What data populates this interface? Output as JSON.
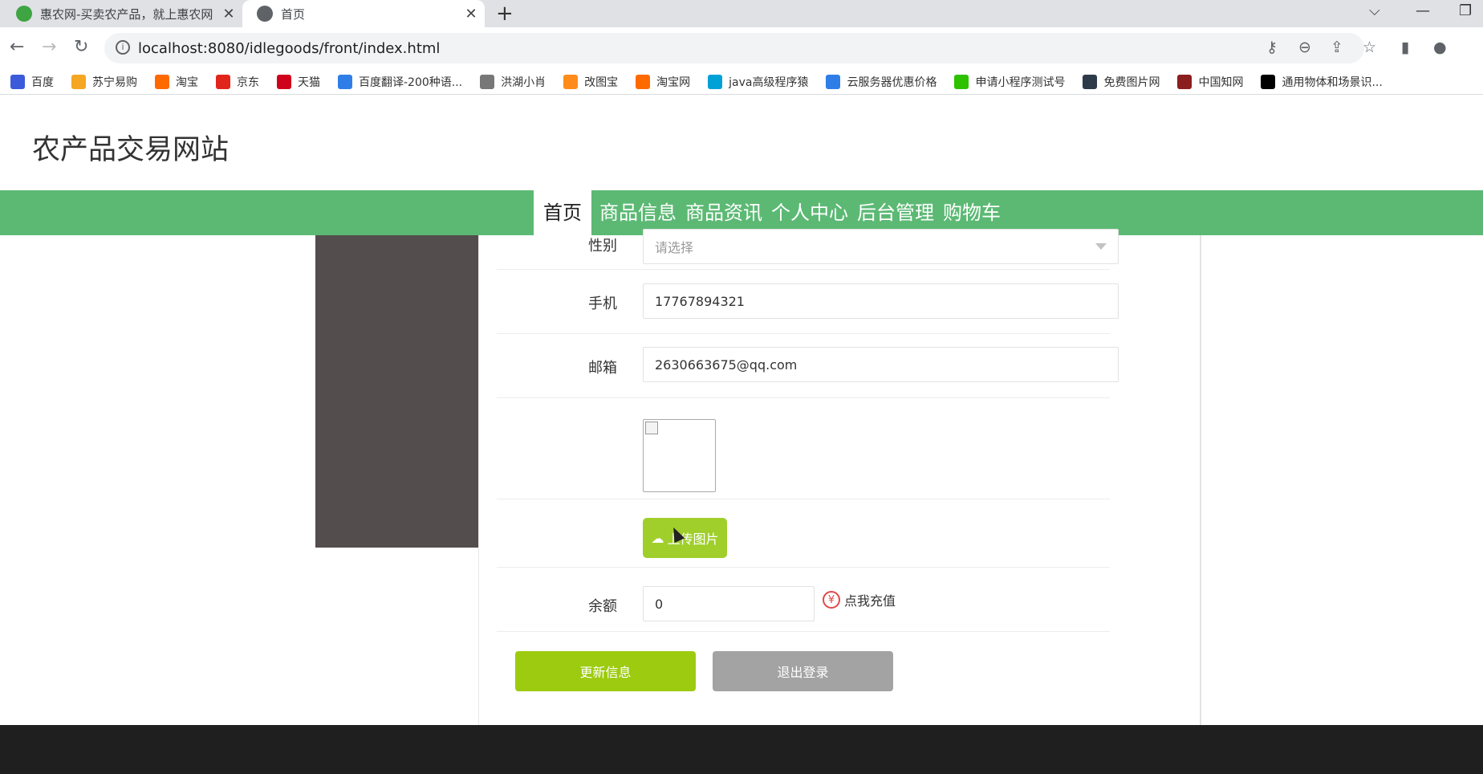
{
  "browser": {
    "tabs": [
      {
        "title": "惠农网-买卖农产品，就上惠农网",
        "active": false,
        "favicon_color": "#3fa543"
      },
      {
        "title": "首页",
        "active": true,
        "favicon_color": "#5f6368"
      }
    ],
    "url": "localhost:8080/idlegoods/front/index.html",
    "bookmarks": [
      {
        "label": "百度",
        "icon": "paw-icon",
        "color": "#3b5bdb"
      },
      {
        "label": "苏宁易购",
        "icon": "lion-icon",
        "color": "#f5a623"
      },
      {
        "label": "淘宝",
        "icon": "taobao-icon",
        "color": "#ff6a00"
      },
      {
        "label": "京东",
        "icon": "jd-icon",
        "color": "#e1251b"
      },
      {
        "label": "天猫",
        "icon": "tmall-icon",
        "color": "#d0021b"
      },
      {
        "label": "百度翻译-200种语...",
        "icon": "translate-icon",
        "color": "#2f7ee8"
      },
      {
        "label": "洪湖小肖",
        "icon": "bird-icon",
        "color": "#777777"
      },
      {
        "label": "改图宝",
        "icon": "image-icon",
        "color": "#ff8c1a"
      },
      {
        "label": "淘宝网",
        "icon": "taobao-icon",
        "color": "#ff6a00"
      },
      {
        "label": "java高级程序猿",
        "icon": "bilibili-icon",
        "color": "#00a1d6"
      },
      {
        "label": "云服务器优惠价格",
        "icon": "cloud-icon",
        "color": "#2f7ee8"
      },
      {
        "label": "申请小程序测试号",
        "icon": "wechat-icon",
        "color": "#2dc100"
      },
      {
        "label": "免费图片网",
        "icon": "t-icon",
        "color": "#2d3a4a"
      },
      {
        "label": "中国知网",
        "icon": "cnki-icon",
        "color": "#8b1e1e"
      },
      {
        "label": "通用物体和场景识...",
        "icon": "ai-icon",
        "color": "#000000"
      }
    ]
  },
  "site": {
    "title": "农产品交易网站",
    "nav": [
      {
        "label": "首页",
        "active": true
      },
      {
        "label": "商品信息",
        "active": false
      },
      {
        "label": "商品资讯",
        "active": false
      },
      {
        "label": "个人中心",
        "active": false
      },
      {
        "label": "后台管理",
        "active": false
      },
      {
        "label": "购物车",
        "active": false
      }
    ]
  },
  "form": {
    "gender_label": "性别",
    "gender_placeholder": "请选择",
    "phone_label": "手机",
    "phone_value": "17767894321",
    "email_label": "邮箱",
    "email_value": "2630663675@qq.com",
    "upload_label": "上传图片",
    "balance_label": "余额",
    "balance_value": "0",
    "recharge_label": "点我充值",
    "recharge_icon": "yen-icon",
    "update_button": "更新信息",
    "logout_button": "退出登录"
  },
  "colors": {
    "nav_green": "#5cb974",
    "upload_green": "#a0cf2b",
    "update_green": "#9ccb0f",
    "logout_gray": "#a3a3a3",
    "sidebar_dark": "#544d4d"
  }
}
